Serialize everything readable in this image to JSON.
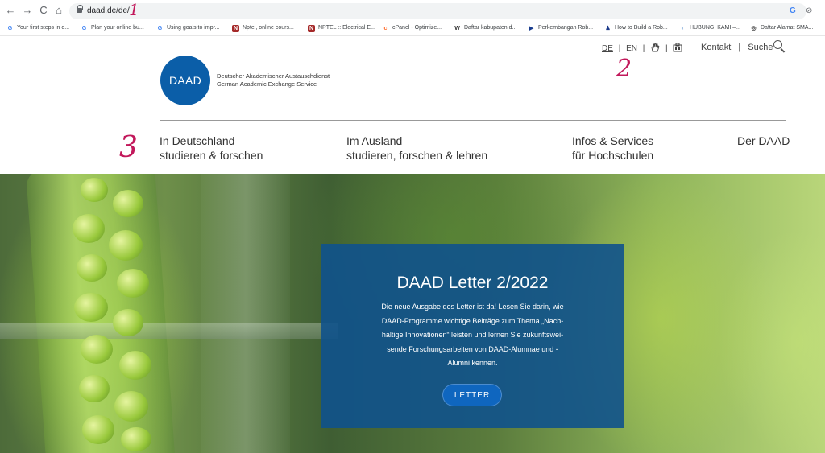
{
  "browser": {
    "url": "daad.de/de/",
    "back_icon": "←",
    "forward_icon": "→",
    "reload_icon": "C",
    "home_icon": "⌂",
    "omni_right_icons": [
      "G",
      "⊘"
    ],
    "bookmarks": [
      {
        "label": "Your first steps in o...",
        "icon": "G",
        "color": "#4285f4"
      },
      {
        "label": "Plan your online bu...",
        "icon": "G",
        "color": "#4285f4"
      },
      {
        "label": "Using goals to impr...",
        "icon": "G",
        "color": "#4285f4"
      },
      {
        "label": "Nptel, online cours...",
        "icon": "N",
        "color": "#a52a2a"
      },
      {
        "label": "NPTEL :: Electrical E...",
        "icon": "N",
        "color": "#a52a2a"
      },
      {
        "label": "cPanel - Optimize...",
        "icon": "c",
        "color": "#ff6c2c"
      },
      {
        "label": "Daftar kabupaten d...",
        "icon": "W",
        "color": "#666666"
      },
      {
        "label": "Perkembangan Rob...",
        "icon": "▶",
        "color": "#1a3d8f"
      },
      {
        "label": "How to Build a Rob...",
        "icon": "♟",
        "color": "#1b3a8a"
      },
      {
        "label": "HUBUNGI KAMI –...",
        "icon": "◐",
        "color": "#2a6fbf"
      },
      {
        "label": "Daftar Alamat SMA...",
        "icon": "◎",
        "color": "#333333"
      }
    ]
  },
  "annotations": {
    "one": "1",
    "two": "2",
    "three": "3"
  },
  "header": {
    "logo_text": "DAAD",
    "org_line1": "Deutscher Akademischer Austauschdienst",
    "org_line2": "German Academic Exchange Service",
    "lang_de": "DE",
    "lang_sep": "|",
    "lang_en": "EN",
    "icon_hand": "hand-sign-language-icon",
    "icon_easy": "easy-language-icon",
    "contact": "Kontakt",
    "search": "Suche"
  },
  "nav": [
    {
      "line1": "In Deutschland",
      "line2": "studieren & forschen"
    },
    {
      "line1": "Im Ausland",
      "line2": "studieren, forschen & lehren"
    },
    {
      "line1": "Infos & Services",
      "line2": "für Hochschulen"
    },
    {
      "line1": "Der DAAD",
      "line2": ""
    }
  ],
  "hero": {
    "title": "DAAD Letter 2/2022",
    "body_lines": [
      "Die neue Ausgabe des Letter ist da! Lesen Sie darin, wie",
      "DAAD-Programme wichtige Beiträge zum Thema „Nach-",
      "haltige Innovationen“ leisten und lernen Sie zukunftswei-",
      "sende Forschungsarbeiten von DAAD-Alumnae und -",
      "Alumni kennen."
    ],
    "button": "LETTER"
  }
}
